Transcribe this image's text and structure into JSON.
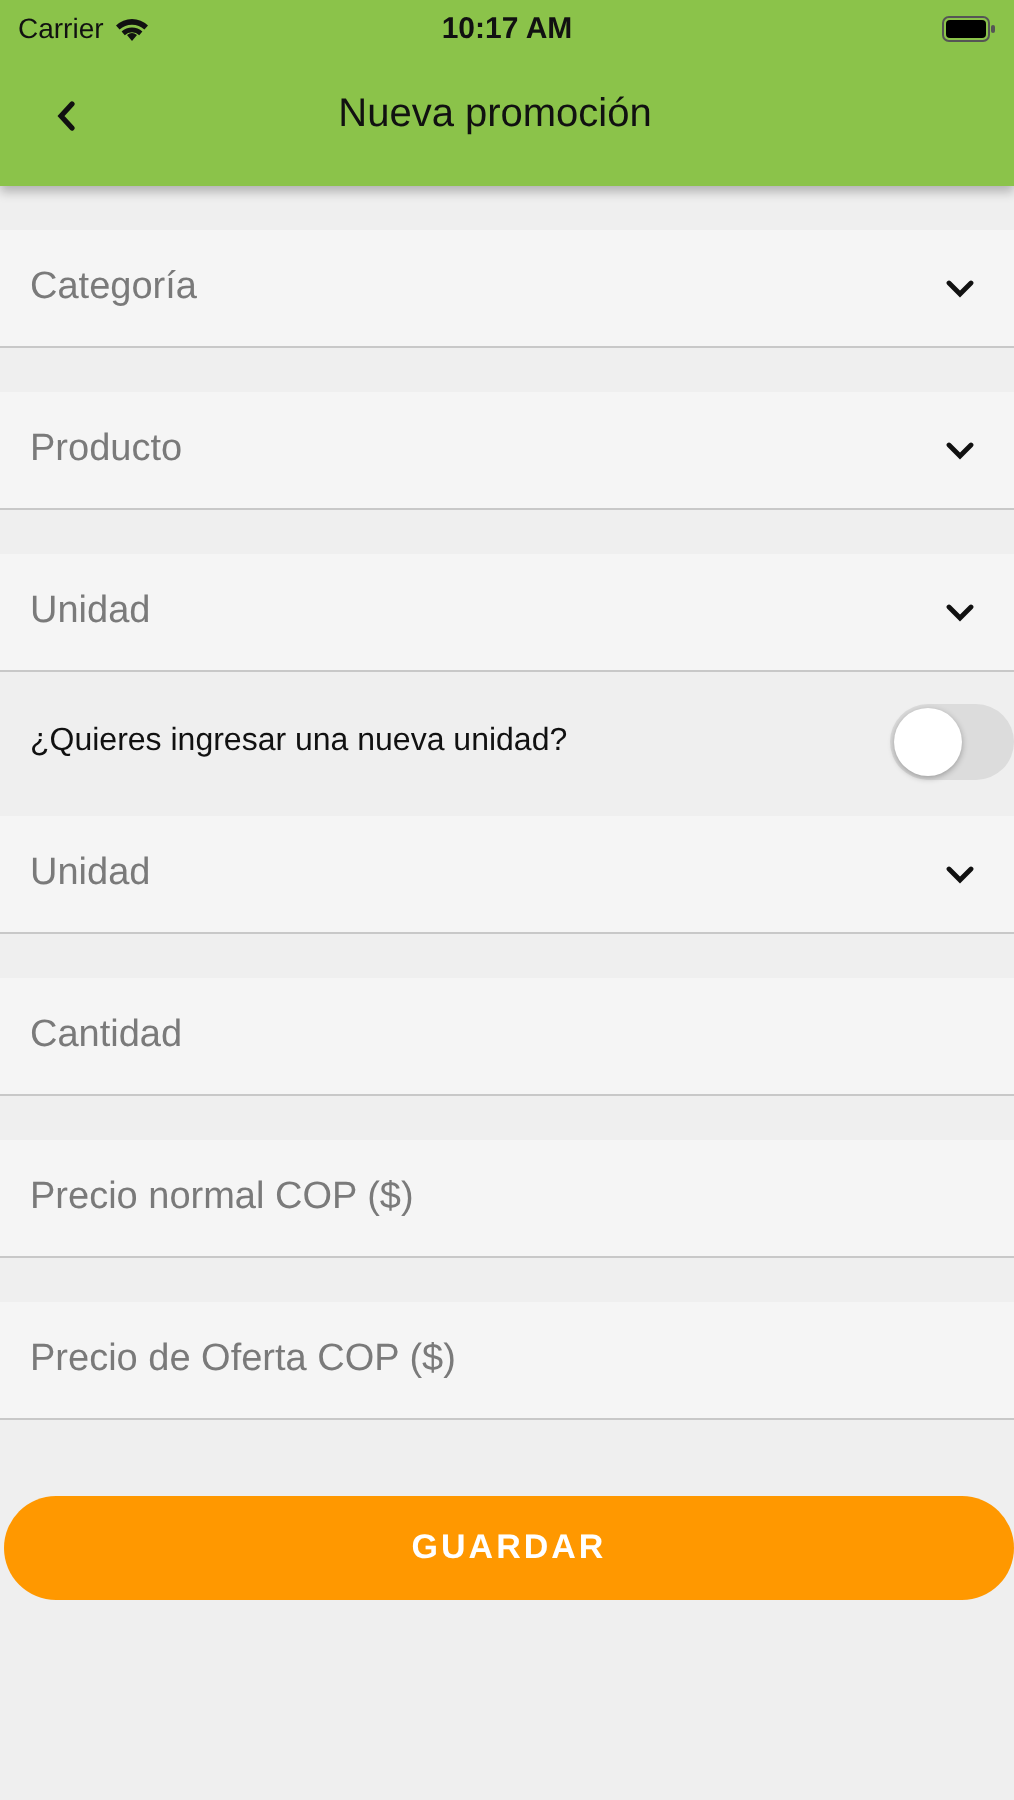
{
  "status_bar": {
    "carrier": "Carrier",
    "time": "10:17 AM"
  },
  "header": {
    "title": "Nueva promoción"
  },
  "form": [
    {
      "kind": "select",
      "placeholder": "Categoría"
    },
    {
      "kind": "select",
      "placeholder": "Producto"
    },
    {
      "kind": "select",
      "placeholder": "Unidad"
    },
    {
      "kind": "toggle",
      "label": "¿Quieres ingresar una nueva unidad?",
      "on": false
    },
    {
      "kind": "select",
      "placeholder": "Unidad"
    },
    {
      "kind": "input",
      "placeholder": "Cantidad"
    },
    {
      "kind": "input",
      "placeholder": "Precio normal COP ($)"
    },
    {
      "kind": "input",
      "placeholder": "Precio de Oferta COP ($)"
    }
  ],
  "save_button": {
    "label": "GUARDAR"
  }
}
